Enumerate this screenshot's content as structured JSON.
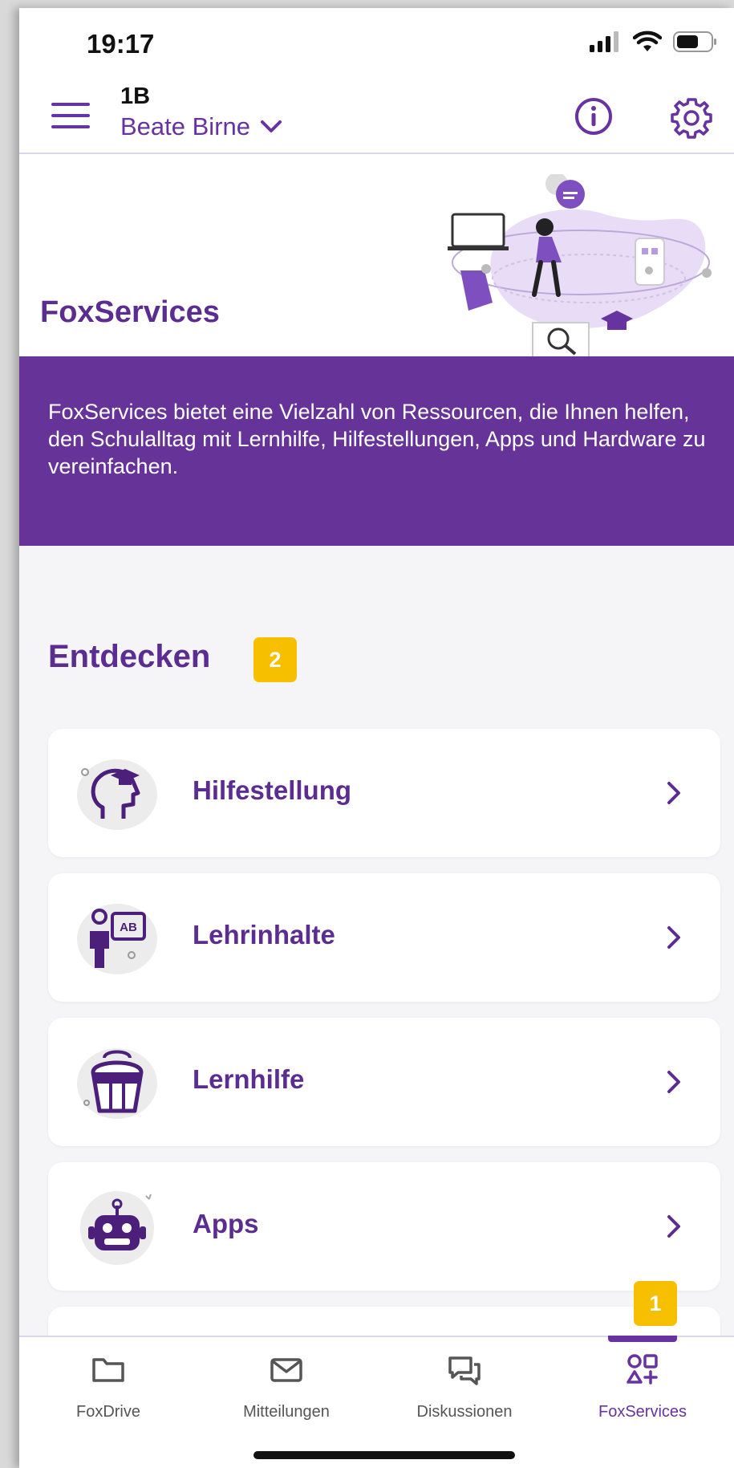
{
  "status_bar": {
    "time": "19:17"
  },
  "header": {
    "class_name": "1B",
    "user_name": "Beate Birne"
  },
  "hero": {
    "title": "FoxServices",
    "description": "FoxServices bietet eine Vielzahl von Ressourcen, die Ihnen helfen, den Schulalltag mit Lernhilfe, Hilfestellungen, Apps und Hardware zu vereinfachen."
  },
  "discover": {
    "title": "Entdecken",
    "badge": "2",
    "items": [
      {
        "label": "Hilfestellung",
        "icon": "head-graduation-icon"
      },
      {
        "label": "Lehrinhalte",
        "icon": "teacher-board-icon"
      },
      {
        "label": "Lernhilfe",
        "icon": "backpack-icon"
      },
      {
        "label": "Apps",
        "icon": "robot-icon"
      }
    ]
  },
  "tab_bar": {
    "badge": "1",
    "tabs": [
      {
        "label": "FoxDrive",
        "icon": "folder-icon"
      },
      {
        "label": "Mitteilungen",
        "icon": "mail-icon"
      },
      {
        "label": "Diskussionen",
        "icon": "chat-icon"
      },
      {
        "label": "FoxServices",
        "icon": "services-icon",
        "active": true
      }
    ]
  },
  "colors": {
    "primary": "#663399",
    "badge": "#f6c000"
  }
}
